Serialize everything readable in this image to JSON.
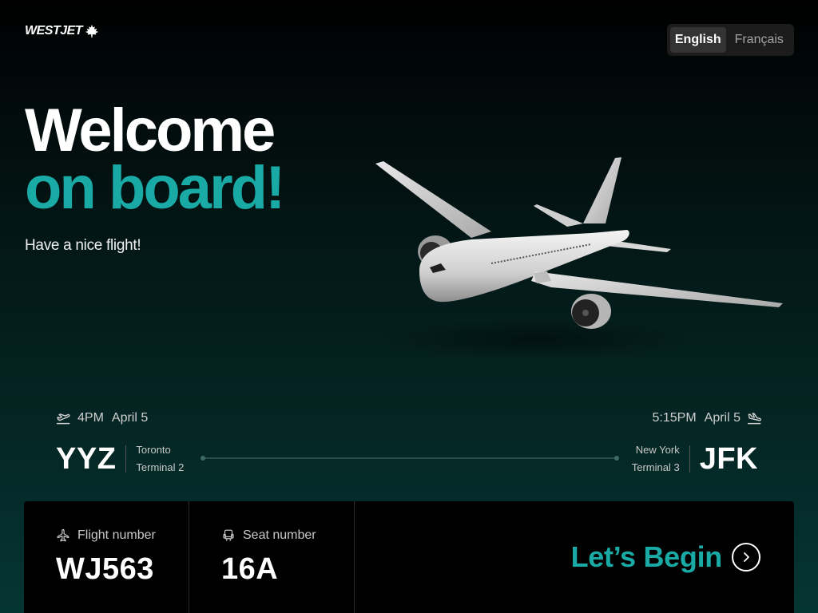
{
  "brand": {
    "name": "WESTJET",
    "logo_icon": "maple-leaf-icon"
  },
  "language": {
    "options": [
      "English",
      "Français"
    ],
    "selected": "English"
  },
  "hero": {
    "title_line1": "Welcome",
    "title_line2": "on board!",
    "subtitle": "Have a nice flight!",
    "accent_color": "#1aaaa5"
  },
  "flight": {
    "departure": {
      "icon": "plane-takeoff-icon",
      "time": "4PM",
      "date": "April 5",
      "code": "YYZ",
      "city": "Toronto",
      "terminal": "Terminal 2"
    },
    "arrival": {
      "icon": "plane-landing-icon",
      "time": "5:15PM",
      "date": "April 5",
      "code": "JFK",
      "city": "New York",
      "terminal": "Terminal 3"
    }
  },
  "details": {
    "flight_number": {
      "label": "Flight number",
      "value": "WJ563",
      "icon": "plane-icon"
    },
    "seat_number": {
      "label": "Seat number",
      "value": "16A",
      "icon": "seat-icon"
    }
  },
  "cta": {
    "label": "Let’s Begin",
    "icon": "chevron-right-icon"
  }
}
